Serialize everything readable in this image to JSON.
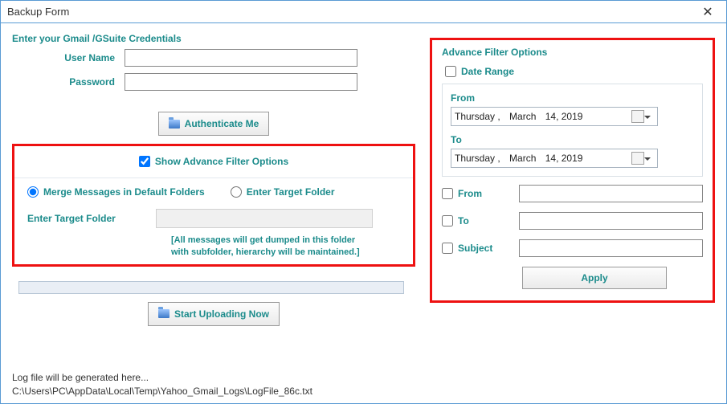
{
  "window": {
    "title": "Backup Form",
    "close": "✕"
  },
  "credentials": {
    "legend": "Enter your Gmail /GSuite Credentials",
    "username_label": "User Name",
    "password_label": "Password",
    "username_value": "",
    "password_value": "",
    "auth_button": "Authenticate Me"
  },
  "filter_toggle": {
    "label": "Show Advance Filter Options"
  },
  "merge_options": {
    "merge_label": "Merge Messages in Default Folders",
    "target_label": "Enter Target Folder",
    "target_field_label": "Enter Target Folder",
    "hint_line1": "[All messages will get dumped in this folder",
    "hint_line2": "with subfolder, hierarchy will be maintained.]"
  },
  "upload_button": "Start Uploading Now",
  "advance": {
    "legend": "Advance Filter Options",
    "date_range_label": "Date Range",
    "from_label": "From",
    "to_label": "To",
    "from_date": {
      "weekday": "Thursday ,",
      "month": "March",
      "day_year": "14, 2019"
    },
    "to_date": {
      "weekday": "Thursday ,",
      "month": "March",
      "day_year": "14, 2019"
    },
    "addr_from_label": "From",
    "addr_to_label": "To",
    "subject_label": "Subject",
    "apply_label": "Apply"
  },
  "footer": {
    "line1": "Log file will be generated here...",
    "line2": "C:\\Users\\PC\\AppData\\Local\\Temp\\Yahoo_Gmail_Logs\\LogFile_86c.txt"
  }
}
